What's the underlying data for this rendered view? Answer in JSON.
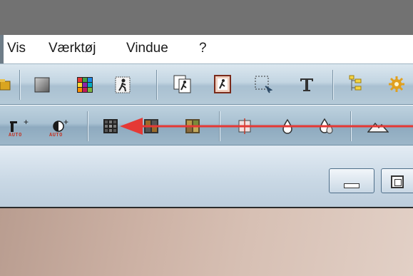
{
  "menu": {
    "items": [
      {
        "label": "Vis"
      },
      {
        "label": "Værktøj"
      },
      {
        "label": "Vindue"
      },
      {
        "label": "?"
      }
    ]
  },
  "toolbar_top": {
    "icons": [
      "folder-icon",
      "gray-square-icon",
      "color-grid-icon",
      "runner-icon",
      "copy-runner-icon",
      "paste-runner-icon",
      "marquee-select-icon",
      "text-tool-icon",
      "tree-icon",
      "gear-icon"
    ]
  },
  "toolbar_bottom": {
    "auto_label": "AUTO",
    "plus_label": "+",
    "icons": [
      "gamma-auto-icon",
      "contrast-auto-icon",
      "dark-grid-icon",
      "split-grid-icon",
      "mixed-grid-icon",
      "crosshair-grid-icon",
      "drop-icon",
      "double-drop-icon",
      "mountain-icon"
    ]
  },
  "annotation": {
    "arrow_color": "#e53935",
    "points_to": "dark-grid-icon"
  },
  "colors": {
    "accent_arrow": "#e53935",
    "titlebar": "#727272"
  }
}
